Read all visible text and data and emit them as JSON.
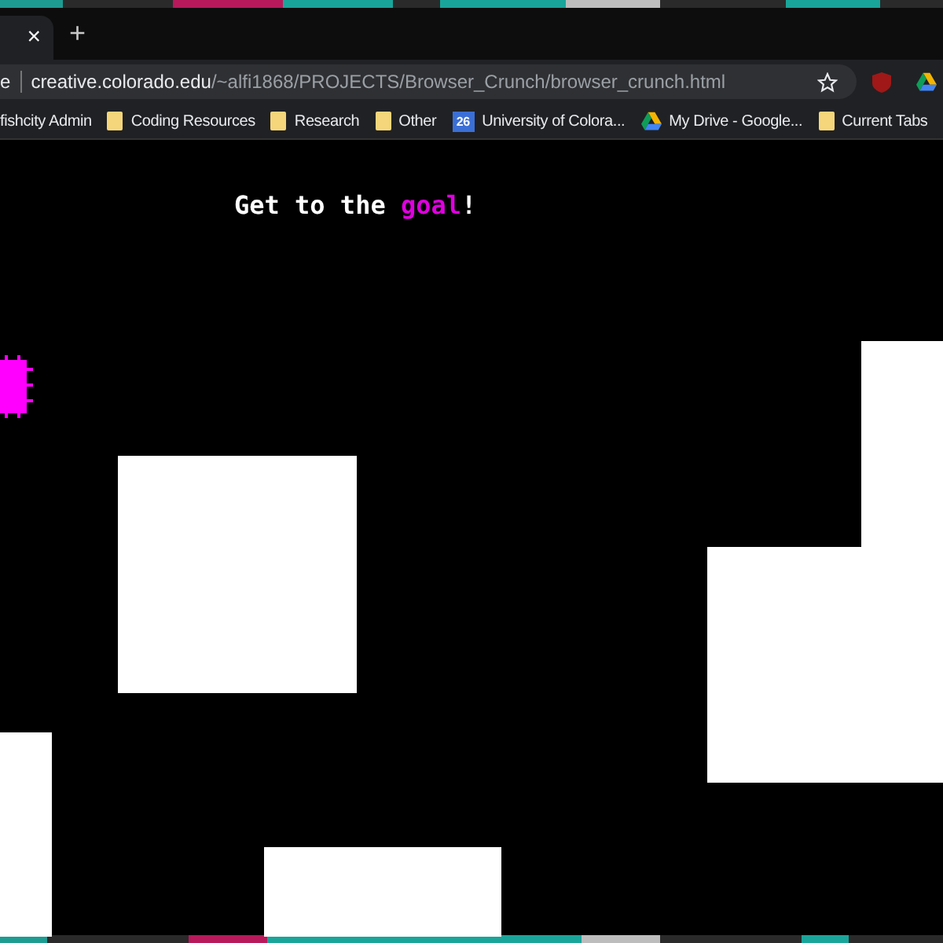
{
  "tab_strip": {
    "close": "×",
    "new_tab": "+"
  },
  "address_bar": {
    "security_label": "e",
    "host": "creative.colorado.edu",
    "path": "/~alfi1868/PROJECTS/Browser_Crunch/browser_crunch.html"
  },
  "bookmarks": [
    {
      "kind": "none",
      "label": "fishcity Admin"
    },
    {
      "kind": "folder",
      "label": "Coding Resources"
    },
    {
      "kind": "folder",
      "label": "Research"
    },
    {
      "kind": "folder",
      "label": "Other"
    },
    {
      "kind": "calendar",
      "icon_text": "26",
      "label": "University of Colora..."
    },
    {
      "kind": "drive",
      "label": "My Drive - Google..."
    },
    {
      "kind": "folder",
      "label": "Current Tabs"
    }
  ],
  "game": {
    "heading": [
      {
        "kind": "plain",
        "text": "Get to the "
      },
      {
        "kind": "accent",
        "text": "goal"
      },
      {
        "kind": "plain",
        "text": "!"
      }
    ]
  }
}
